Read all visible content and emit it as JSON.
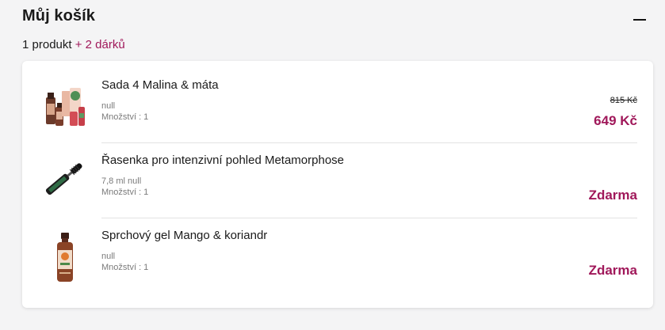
{
  "cart": {
    "title": "Můj košík",
    "summary_count": "1 produkt",
    "summary_gifts": "+ 2 dárků"
  },
  "items": [
    {
      "name": "Sada 4 Malina & máta",
      "line1": "null",
      "line2": "Množství : 1",
      "old_price": "815 Kč",
      "price": "649 Kč"
    },
    {
      "name": "Řasenka pro intenzivní pohled Metamorphose",
      "line1": "7,8 ml null",
      "line2": "Množství : 1",
      "price": "Zdarma"
    },
    {
      "name": "Sprchový gel Mango & koriandr",
      "line1": "null",
      "line2": "Množství : 1",
      "price": "Zdarma"
    }
  ],
  "colors": {
    "accent": "#a0185a",
    "background": "#f4f4f5",
    "card": "#ffffff"
  },
  "icons": {
    "collapse": "minus-icon"
  }
}
